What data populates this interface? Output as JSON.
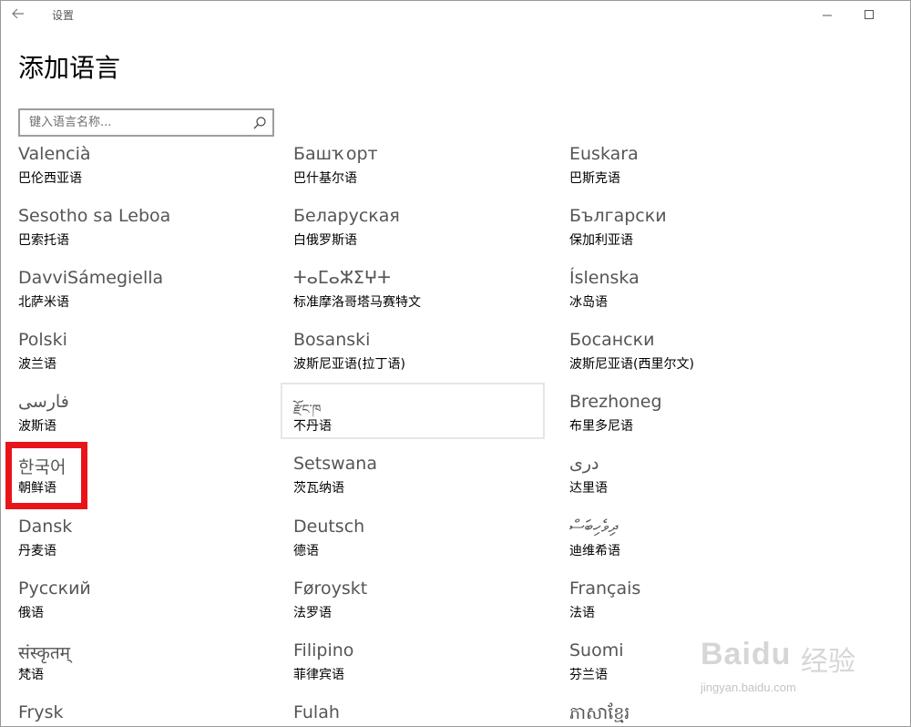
{
  "window": {
    "app_title": "设置",
    "icons": {
      "back": "back-arrow-icon",
      "minimize": "minimize-icon",
      "maximize": "maximize-icon",
      "search": "search-icon"
    }
  },
  "page": {
    "title": "添加语言"
  },
  "search": {
    "placeholder": "键入语言名称...",
    "value": ""
  },
  "languages": [
    {
      "native": "Valencià",
      "chinese": "巴伦西亚语"
    },
    {
      "native": "Башҡорт",
      "chinese": "巴什基尔语"
    },
    {
      "native": "Euskara",
      "chinese": "巴斯克语"
    },
    {
      "native": "Sesotho sa Leboa",
      "chinese": "巴索托语"
    },
    {
      "native": "Беларуская",
      "chinese": "白俄罗斯语"
    },
    {
      "native": "Български",
      "chinese": "保加利亚语"
    },
    {
      "native": "DavviSámegiella",
      "chinese": "北萨米语"
    },
    {
      "native": "ⵜⴰⵎⴰⵣⵉⵖⵜ",
      "chinese": "标准摩洛哥塔马赛特文"
    },
    {
      "native": "Íslenska",
      "chinese": "冰岛语"
    },
    {
      "native": "Polski",
      "chinese": "波兰语"
    },
    {
      "native": "Bosanski",
      "chinese": "波斯尼亚语(拉丁语)"
    },
    {
      "native": "Босански",
      "chinese": "波斯尼亚语(西里尔文)"
    },
    {
      "native": "فارسی",
      "chinese": "波斯语"
    },
    {
      "native": "རྫོང་ཁ",
      "chinese": "不丹语"
    },
    {
      "native": "Brezhoneg",
      "chinese": "布里多尼语"
    },
    {
      "native": "한국어",
      "chinese": "朝鲜语"
    },
    {
      "native": "Setswana",
      "chinese": "茨瓦纳语"
    },
    {
      "native": "درى",
      "chinese": "达里语"
    },
    {
      "native": "Dansk",
      "chinese": "丹麦语"
    },
    {
      "native": "Deutsch",
      "chinese": "德语"
    },
    {
      "native": "ދިވެހިބަސް",
      "chinese": "迪维希语"
    },
    {
      "native": "Русский",
      "chinese": "俄语"
    },
    {
      "native": "Føroyskt",
      "chinese": "法罗语"
    },
    {
      "native": "Français",
      "chinese": "法语"
    },
    {
      "native": "संस्कृतम्",
      "chinese": "梵语"
    },
    {
      "native": "Filipino",
      "chinese": "菲律宾语"
    },
    {
      "native": "Suomi",
      "chinese": "芬兰语"
    },
    {
      "native": "Frysk",
      "chinese": ""
    },
    {
      "native": "Fulah",
      "chinese": ""
    },
    {
      "native": "ភាសាខ្មែរ",
      "chinese": ""
    }
  ],
  "watermark": {
    "brand": "Baidu",
    "brand_cn": "经验",
    "url": "jingyan.baidu.com"
  },
  "colors": {
    "highlight_box": "#e8141a",
    "hover_border": "#e6e6e6",
    "native_text": "#555555"
  }
}
